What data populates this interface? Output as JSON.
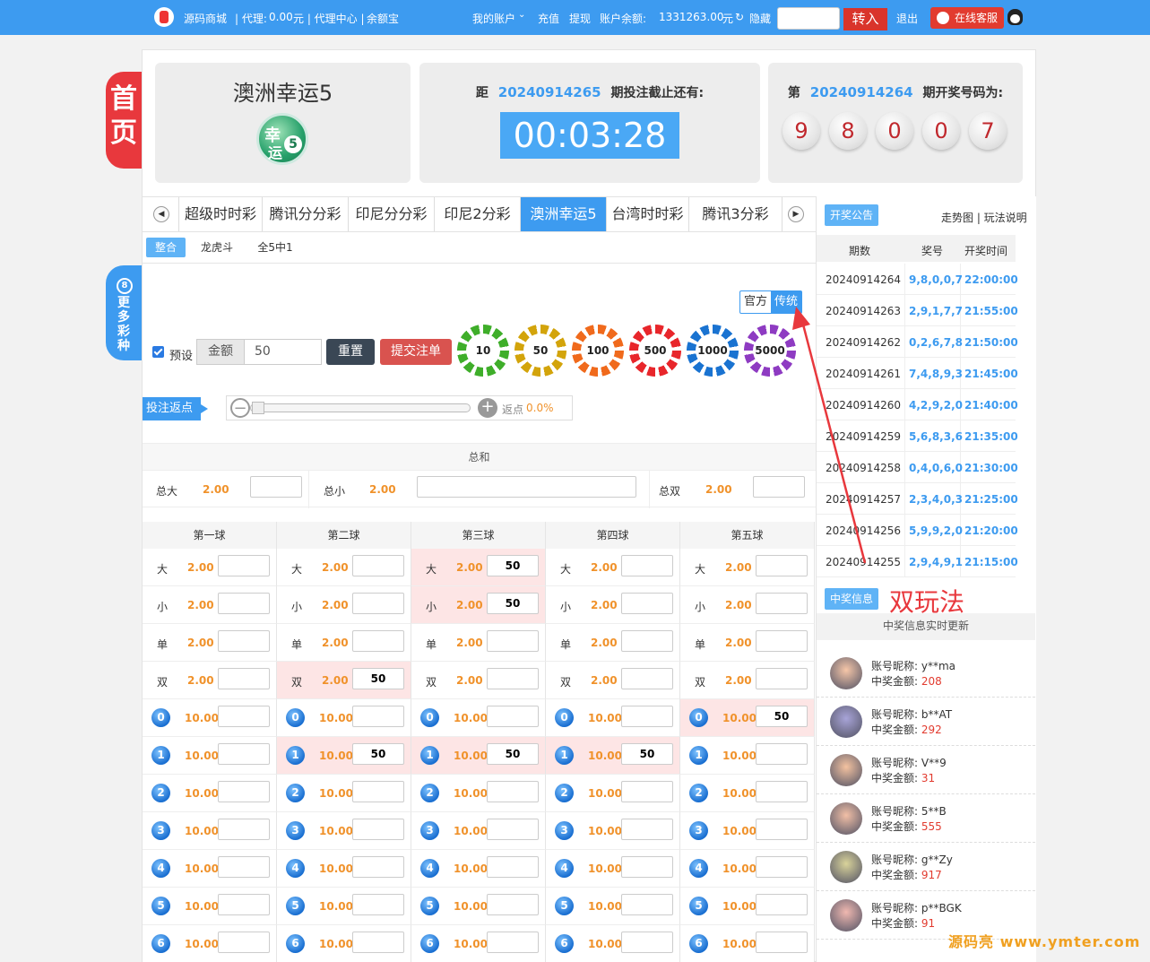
{
  "topbar": {
    "brand": "源码商城",
    "agent_label": "| 代理:",
    "agent_amount": "0.00",
    "agent_unit": "元 | 代理中心 |",
    "yuebao": "余额宝",
    "my_account": "我的账户",
    "deposit": "充值",
    "withdraw": "提现",
    "balance_label": "账户余额:",
    "balance_value": "1331263.00",
    "balance_unit": "元",
    "hide": "隐藏",
    "transfer_btn": "转入",
    "logout": "退出",
    "service": "在线客服"
  },
  "side": {
    "home": "首页",
    "more_badge": "8",
    "more": "更多彩种"
  },
  "header": {
    "lottery_name": "澳洲幸运5",
    "countdown_prefix": "距",
    "countdown_period": "20240914265",
    "countdown_suffix": "期投注截止还有:",
    "timer": "00:03:28",
    "draw_prefix": "第",
    "draw_period": "20240914264",
    "draw_suffix": "期开奖号码为:",
    "draw_balls": [
      "9",
      "8",
      "0",
      "0",
      "7"
    ]
  },
  "tabs": [
    "超级时时彩",
    "腾讯分分彩",
    "印尼分分彩",
    "印尼2分彩",
    "澳洲幸运5",
    "台湾时时彩",
    "腾讯3分彩"
  ],
  "subtabs": [
    "整合",
    "龙虎斗",
    "全5中1"
  ],
  "mode": {
    "official": "官方",
    "traditional": "传统"
  },
  "bet": {
    "preset": "预设",
    "amount_label": "金额",
    "amount_value": "50",
    "reset": "重置",
    "submit": "提交注单",
    "chips": [
      "10",
      "50",
      "100",
      "500",
      "1000",
      "5000"
    ]
  },
  "rebate": {
    "label": "投注返点",
    "text": "返点",
    "value": "0.0%"
  },
  "sum": {
    "title": "总和",
    "items": [
      {
        "label": "总大",
        "odds": "2.00"
      },
      {
        "label": "总小",
        "odds": "2.00"
      },
      {
        "label": "总双",
        "odds": "2.00"
      }
    ]
  },
  "columns": [
    "第一球",
    "第二球",
    "第三球",
    "第四球",
    "第五球"
  ],
  "rows": [
    {
      "label": "大",
      "odds": "2.00",
      "bets": [
        "",
        "",
        "50",
        "",
        ""
      ]
    },
    {
      "label": "小",
      "odds": "2.00",
      "bets": [
        "",
        "",
        "50",
        "",
        ""
      ]
    },
    {
      "label": "单",
      "odds": "2.00",
      "bets": [
        "",
        "",
        "",
        "",
        ""
      ]
    },
    {
      "label": "双",
      "odds": "2.00",
      "bets": [
        "",
        "50",
        "",
        "",
        ""
      ]
    },
    {
      "ball": "0",
      "odds": "10.00",
      "bets": [
        "",
        "",
        "",
        "",
        "50"
      ]
    },
    {
      "ball": "1",
      "odds": "10.00",
      "bets": [
        "",
        "50",
        "50",
        "50",
        ""
      ]
    },
    {
      "ball": "2",
      "odds": "10.00",
      "bets": [
        "",
        "",
        "",
        "",
        ""
      ]
    },
    {
      "ball": "3",
      "odds": "10.00",
      "bets": [
        "",
        "",
        "",
        "",
        ""
      ]
    },
    {
      "ball": "4",
      "odds": "10.00",
      "bets": [
        "",
        "",
        "",
        "",
        ""
      ]
    },
    {
      "ball": "5",
      "odds": "10.00",
      "bets": [
        "",
        "",
        "",
        "",
        ""
      ]
    },
    {
      "ball": "6",
      "odds": "10.00",
      "bets": [
        "",
        "",
        "",
        "",
        ""
      ]
    }
  ],
  "right": {
    "notice_badge": "开奖公告",
    "links": "走势图 | 玩法说明",
    "headers": [
      "期数",
      "奖号",
      "开奖时间"
    ],
    "results": [
      {
        "period": "20240914264",
        "nums": "9,8,0,0,7",
        "time": "22:00:00"
      },
      {
        "period": "20240914263",
        "nums": "2,9,1,7,7",
        "time": "21:55:00"
      },
      {
        "period": "20240914262",
        "nums": "0,2,6,7,8",
        "time": "21:50:00"
      },
      {
        "period": "20240914261",
        "nums": "7,4,8,9,3",
        "time": "21:45:00"
      },
      {
        "period": "20240914260",
        "nums": "4,2,9,2,0",
        "time": "21:40:00"
      },
      {
        "period": "20240914259",
        "nums": "5,6,8,3,6",
        "time": "21:35:00"
      },
      {
        "period": "20240914258",
        "nums": "0,4,0,6,0",
        "time": "21:30:00"
      },
      {
        "period": "20240914257",
        "nums": "2,3,4,0,3",
        "time": "21:25:00"
      },
      {
        "period": "20240914256",
        "nums": "5,9,9,2,0",
        "time": "21:20:00"
      },
      {
        "period": "20240914255",
        "nums": "2,9,4,9,1",
        "time": "21:15:00"
      }
    ],
    "win_badge": "中奖信息",
    "win_sub": "中奖信息实时更新",
    "nick_label": "账号昵称:",
    "amount_label": "中奖金额:",
    "winners": [
      {
        "nick": "y**ma",
        "amount": "208"
      },
      {
        "nick": "b**AT",
        "amount": "292"
      },
      {
        "nick": "V**9",
        "amount": "31"
      },
      {
        "nick": "5**B",
        "amount": "555"
      },
      {
        "nick": "g**Zy",
        "amount": "917"
      },
      {
        "nick": "p**BGK",
        "amount": "91"
      }
    ]
  },
  "annotation": "双玩法",
  "watermark": "源码亮 www.ymter.com",
  "colors": {
    "accent": "#3d9bf0",
    "danger": "#e23b2f",
    "odds": "#f0922b",
    "highlight": "#fde5e5"
  }
}
